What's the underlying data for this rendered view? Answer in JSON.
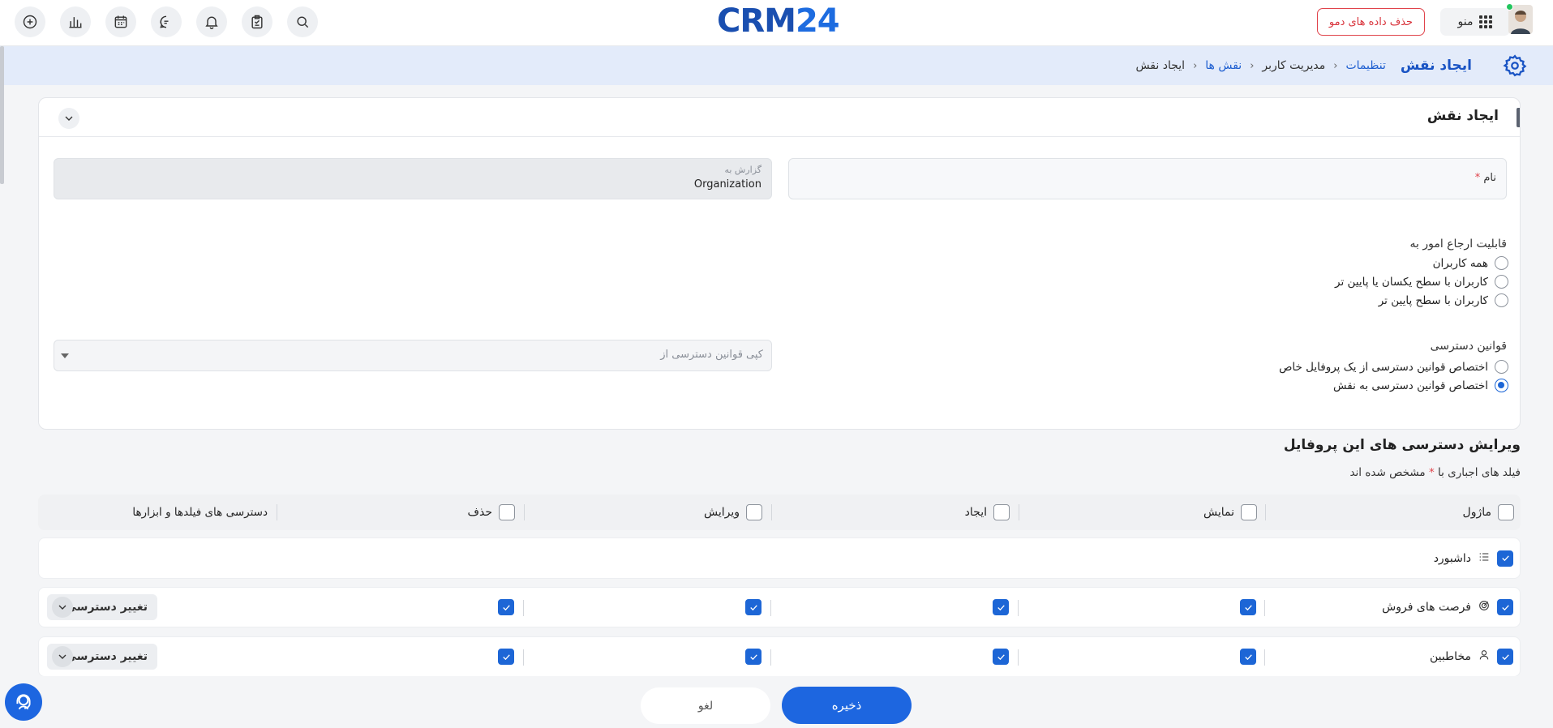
{
  "topbar": {
    "logo_crm": "CRM",
    "logo_24": "24",
    "demo_button": "حذف داده های دمو",
    "menu_label": "منو",
    "icons": [
      "add-icon",
      "chart-icon",
      "calendar-icon",
      "chat-icon",
      "bell-icon",
      "clipboard-icon",
      "search-icon"
    ]
  },
  "breadcrumb": {
    "title": "ایجاد نقش",
    "items": [
      "تنظیمات",
      "مدیریت کاربر",
      "نقش ها",
      "ایجاد نقش"
    ]
  },
  "form": {
    "card_title": "ایجاد نقش",
    "name_label": "نام",
    "required_mark": "*",
    "report_to_label": "گزارش به",
    "report_to_value": "Organization",
    "assign_label": "قابلیت ارجاع امور به",
    "assign_options": [
      "همه کاربران",
      "کاربران با سطح یکسان یا پایین تر",
      "کاربران با سطح پایین تر"
    ],
    "access_label": "قوانین دسترسی",
    "access_options": [
      "اختصاص قوانین دسترسی از یک پروفایل خاص",
      "اختصاص قوانین دسترسی به نقش"
    ],
    "access_selected": 1,
    "copy_placeholder": "کپی قوانین دسترسی از"
  },
  "permissions": {
    "title": "ویرایش دسترسی های این پروفایل",
    "note_prefix": "فیلد های اجباری با",
    "note_suffix": "مشخص شده اند",
    "headers": {
      "module": "ماژول",
      "view": "نمایش",
      "create": "ایجاد",
      "edit": "ویرایش",
      "delete": "حذف",
      "fields": "دسترسی های فیلدها و ابزارها"
    },
    "rows": [
      {
        "name": "داشبورد",
        "icon": "list-icon"
      },
      {
        "name": "فرصت های فروش",
        "icon": "target-icon",
        "change_label": "تغییر دسترسی"
      },
      {
        "name": "مخاطبین",
        "icon": "user-icon",
        "change_label": "تغییر دسترسی"
      }
    ]
  },
  "actions": {
    "save": "ذخیره",
    "cancel": "لغو"
  },
  "colors": {
    "accent": "#1d66e0",
    "danger": "#d8323a",
    "breadcrumb_bg": "#e3ebfa"
  }
}
